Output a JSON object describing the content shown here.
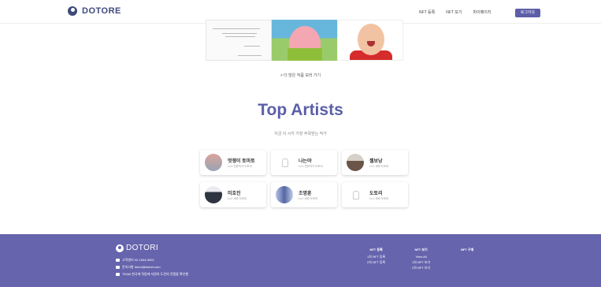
{
  "header": {
    "brand": "DOTORE",
    "nav": [
      "NFT 등록",
      "NFT 보기",
      "마이페이지"
    ],
    "login_label": "로그아웃"
  },
  "gallery": {
    "more_link": "> 더 많은 작품 보러 가기"
  },
  "top_artists": {
    "title": "Top Artists",
    "subtitle": "지금 이 시각 가장 주목받는 작가",
    "artists": [
      {
        "name": "멋쟁이 토마토",
        "sub": "Lv.3 전문작가 도토리"
      },
      {
        "name": "나는야",
        "sub": "Lv.3 전문작가 도토리"
      },
      {
        "name": "젤보낭",
        "sub": "Lv.2 새싹 도토리"
      },
      {
        "name": "미호진",
        "sub": "Lv.2 새싹 도토리"
      },
      {
        "name": "조명훈",
        "sub": "Lv.2 새싹 도토리"
      },
      {
        "name": "도토리",
        "sub": "Lv.1 새싹 도토리"
      }
    ]
  },
  "footer": {
    "brand": "DOTORI",
    "phone": "고객센터 02-1544-9001",
    "email": "문의사항 dotori@dotori.com",
    "team": "TEAM 한국에 직원에 지원의 도전의 전쟁을 확인했",
    "col1": {
      "head": "NFT 등록",
      "items": [
        "1차 NFT 등록",
        "2차 NFT 등록"
      ]
    },
    "col2": {
      "head": "NFT 보기",
      "items": [
        "View All",
        "1차 NFT 보기",
        "2차 NFT 보기"
      ]
    },
    "col3": {
      "head": "NFT 구매",
      "items": []
    }
  },
  "colors": {
    "accent": "#5c5fa8",
    "footer_bg": "#6664ad"
  }
}
